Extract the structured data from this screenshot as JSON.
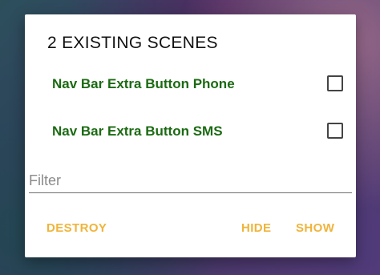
{
  "dialog": {
    "title": "2 EXISTING SCENES",
    "scenes": [
      {
        "label": "Nav Bar Extra Button Phone",
        "checked": false
      },
      {
        "label": "Nav Bar Extra Button SMS",
        "checked": false
      }
    ],
    "filter": {
      "placeholder": "Filter",
      "value": ""
    },
    "actions": {
      "destroy": "DESTROY",
      "hide": "HIDE",
      "show": "SHOW"
    },
    "colors": {
      "scene_label": "#1b6a12",
      "action_text": "#f0b43a"
    }
  }
}
